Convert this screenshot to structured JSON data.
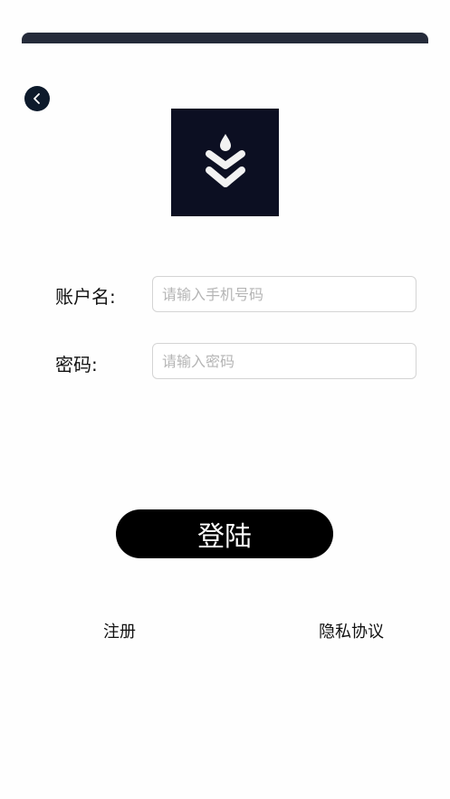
{
  "header": {
    "back_icon": "chevron-left-icon",
    "logo_icon": "stacked-chevrons-drop-icon",
    "colors": {
      "top_bar": "#252b3a",
      "logo_bg": "#0c0f22",
      "back_bg": "#0d1a2b"
    }
  },
  "form": {
    "account_label": "账户名:",
    "account_placeholder": "请输入手机号码",
    "account_value": "",
    "password_label": "密码:",
    "password_placeholder": "请输入密码",
    "password_value": ""
  },
  "login_button": {
    "label": "登陆",
    "color": "#000000"
  },
  "footer": {
    "register_label": "注册",
    "privacy_label": "隐私协议"
  }
}
